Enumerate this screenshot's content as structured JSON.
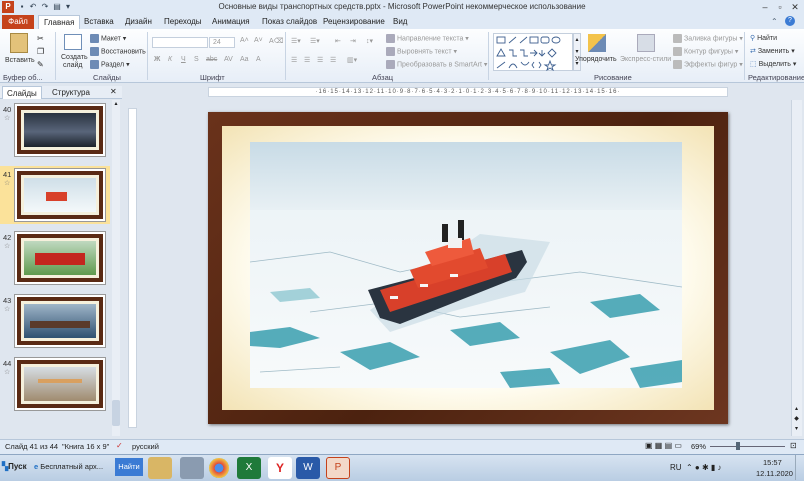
{
  "window": {
    "title": "Основные виды транспортных средств.pptx - Microsoft PowerPoint некоммерческое использование"
  },
  "tabs": {
    "file": "Файл",
    "items": [
      "Главная",
      "Вставка",
      "Дизайн",
      "Переходы",
      "Анимация",
      "Показ слайдов",
      "Рецензирование",
      "Вид"
    ]
  },
  "ribbon": {
    "clipboard": {
      "paste": "Вставить",
      "group": "Буфер об..."
    },
    "slides": {
      "new_slide_1": "Создать",
      "new_slide_2": "слайд",
      "layout": "Макет",
      "reset": "Восстановить",
      "section": "Раздел",
      "group": "Слайды"
    },
    "font": {
      "font_name": "",
      "font_size": "24",
      "group": "Шрифт"
    },
    "paragraph": {
      "text_direction": "Направление текста",
      "align_text": "Выровнять текст",
      "smartart": "Преобразовать в SmartArt",
      "group": "Абзац"
    },
    "drawing": {
      "arrange": "Упорядочить",
      "quick_styles": "Экспресс-стили",
      "shape_fill": "Заливка фигуры",
      "shape_outline": "Контур фигуры",
      "shape_effects": "Эффекты фигур",
      "group": "Рисование"
    },
    "editing": {
      "find": "Найти",
      "replace": "Заменить",
      "select": "Выделить",
      "group": "Редактирование"
    }
  },
  "panel": {
    "tab_slides": "Слайды",
    "tab_outline": "Структура",
    "thumbs": [
      {
        "num": "40"
      },
      {
        "num": "41"
      },
      {
        "num": "42"
      },
      {
        "num": "43"
      },
      {
        "num": "44"
      }
    ]
  },
  "ruler": {
    "h": "·16·15·14·13·12·11·10·9·8·7·6·5·4·3·2·1·0·1·2·3·4·5·6·7·8·9·10·11·12·13·14·15·16·"
  },
  "status": {
    "slide_info": "Слайд 41 из 44",
    "theme": "\"Книга 16 x 9\"",
    "language": "русский",
    "zoom": "69%"
  },
  "taskbar": {
    "start": "Пуск",
    "browser_tab": "Бесплатный арх...",
    "find_btn": "Найти",
    "lang": "RU",
    "time": "15:57",
    "date": "12.11.2020"
  }
}
